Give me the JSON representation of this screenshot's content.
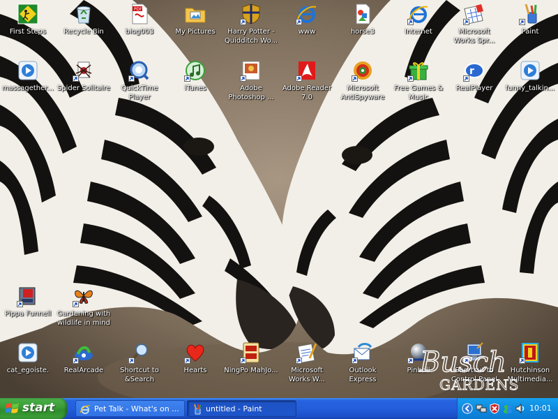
{
  "desktop": {
    "icons": [
      {
        "id": "first-steps",
        "label": "First Steps",
        "icon": "first-steps-icon",
        "shortcut": false
      },
      {
        "id": "recycle-bin",
        "label": "Recycle Bin",
        "icon": "recycle-bin-icon",
        "shortcut": false
      },
      {
        "id": "biog003",
        "label": "biog003",
        "icon": "pdf-document-icon",
        "shortcut": false
      },
      {
        "id": "my-pictures",
        "label": "My Pictures",
        "icon": "folder-icon",
        "shortcut": false
      },
      {
        "id": "harry-potter",
        "label": "Harry Potter - Quidditch Wo...",
        "icon": "game-shield-icon",
        "shortcut": true
      },
      {
        "id": "www",
        "label": "www",
        "icon": "internet-explorer-icon",
        "shortcut": true
      },
      {
        "id": "horse3",
        "label": "horse3",
        "icon": "image-file-icon",
        "shortcut": false
      },
      {
        "id": "internet",
        "label": "Internet",
        "icon": "internet-explorer-icon",
        "shortcut": true
      },
      {
        "id": "works-spreadsheet",
        "label": "Microsoft Works Spr...",
        "icon": "spreadsheet-icon",
        "shortcut": true
      },
      {
        "id": "paint",
        "label": "Paint",
        "icon": "paint-brush-icon",
        "shortcut": true
      },
      {
        "id": "massagether",
        "label": "massagether...",
        "icon": "media-file-icon",
        "shortcut": false
      },
      {
        "id": "spider-solitaire",
        "label": "Spider Solitaire",
        "icon": "spider-icon",
        "shortcut": true
      },
      {
        "id": "quicktime",
        "label": "QuickTime Player",
        "icon": "quicktime-icon",
        "shortcut": true
      },
      {
        "id": "itunes",
        "label": "iTunes",
        "icon": "itunes-icon",
        "shortcut": true
      },
      {
        "id": "photoshop",
        "label": "Adobe Photoshop ...",
        "icon": "photoshop-icon",
        "shortcut": true
      },
      {
        "id": "adobe-reader",
        "label": "Adobe Reader 7.0",
        "icon": "adobe-reader-icon",
        "shortcut": true
      },
      {
        "id": "antispyware",
        "label": "Microsoft AntiSpyware",
        "icon": "antispyware-icon",
        "shortcut": true
      },
      {
        "id": "free-games",
        "label": "Free Games & Music",
        "icon": "gift-icon",
        "shortcut": true
      },
      {
        "id": "realplayer",
        "label": "RealPlayer",
        "icon": "realplayer-icon",
        "shortcut": true
      },
      {
        "id": "funny-talking",
        "label": "funny_talkin...",
        "icon": "media-file-icon",
        "shortcut": false
      },
      {
        "id": "pippa-funnell",
        "label": "Pippa Funnell",
        "icon": "game-box-icon",
        "shortcut": true
      },
      {
        "id": "gardening",
        "label": "Gardening with wildlife in mind",
        "icon": "butterfly-icon",
        "shortcut": true
      },
      {
        "id": "cat-egoiste",
        "label": "cat_egoiste.",
        "icon": "media-file-icon",
        "shortcut": false
      },
      {
        "id": "realarcade",
        "label": "RealArcade",
        "icon": "realarcade-icon",
        "shortcut": true
      },
      {
        "id": "search",
        "label": "Shortcut to &Search",
        "icon": "magnifier-icon",
        "shortcut": true
      },
      {
        "id": "hearts",
        "label": "Hearts",
        "icon": "heart-icon",
        "shortcut": true
      },
      {
        "id": "mahjong",
        "label": "NingPo MahJo...",
        "icon": "mahjong-tile-icon",
        "shortcut": true
      },
      {
        "id": "works-word",
        "label": "Microsoft Works W...",
        "icon": "works-word-icon",
        "shortcut": true
      },
      {
        "id": "outlook-express",
        "label": "Outlook Express",
        "icon": "outlook-express-icon",
        "shortcut": true
      },
      {
        "id": "pinball",
        "label": "Pinball",
        "icon": "pinball-icon",
        "shortcut": true
      },
      {
        "id": "control-panel",
        "label": "Shortcut to Control Panel",
        "icon": "control-panel-icon",
        "shortcut": true
      },
      {
        "id": "hutchinson",
        "label": "Hutchinson Multimedia...",
        "icon": "encyclopedia-icon",
        "shortcut": true
      }
    ],
    "brand_text_1": "Busch",
    "brand_text_2": "GARDENS"
  },
  "taskbar": {
    "start_label": "start",
    "tasks": [
      {
        "label": "Pet Talk - What's on ...",
        "icon": "internet-explorer-icon",
        "active": false
      },
      {
        "label": "untitled - Paint",
        "icon": "paint-brush-icon",
        "active": true
      }
    ],
    "tray_icons": [
      "chevron-left-icon",
      "network-icon",
      "security-alert-icon",
      "messenger-icon",
      "speaker-icon"
    ],
    "clock": "10:01"
  },
  "colors": {
    "taskbar": "#245edb",
    "start": "#3c9e39",
    "tray": "#0f8be0"
  }
}
